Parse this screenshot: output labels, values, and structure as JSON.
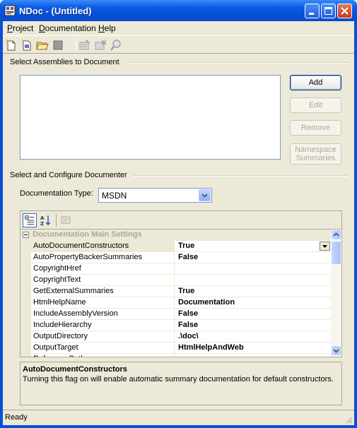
{
  "window": {
    "title": "NDoc - (Untitled)",
    "app_icon": "ndoc-app-icon"
  },
  "caption_buttons": [
    "minimize-icon",
    "maximize-icon",
    "close-icon"
  ],
  "menu": {
    "items": [
      {
        "label": "Project",
        "mnemonic": "P"
      },
      {
        "label": "Documentation",
        "mnemonic": "D"
      },
      {
        "label": "Help",
        "mnemonic": "H"
      }
    ]
  },
  "toolbar": {
    "icons": [
      "new-project-icon",
      "new-from-vs-solution-icon",
      "open-folder-icon",
      "save-icon",
      "build-icon",
      "cancel-build-icon",
      "view-documentation-icon"
    ]
  },
  "assemblies": {
    "group_label": "Select Assemblies to Document",
    "items": [],
    "buttons": {
      "add": "Add",
      "edit": "Edit",
      "remove": "Remove",
      "namespace_summaries": "Namespace Summaries"
    }
  },
  "documenter": {
    "group_label": "Select and Configure Documenter",
    "type_label": "Documentation Type:",
    "type_value": "MSDN"
  },
  "property_grid": {
    "toolbar_icons": [
      "categorized-icon",
      "alphabetical-icon",
      "property-pages-icon"
    ],
    "category": "Documentation Main Settings",
    "rows": [
      {
        "name": "AutoDocumentConstructors",
        "value": "True"
      },
      {
        "name": "AutoPropertyBackerSummaries",
        "value": "False"
      },
      {
        "name": "CopyrightHref",
        "value": ""
      },
      {
        "name": "CopyrightText",
        "value": ""
      },
      {
        "name": "GetExternalSummaries",
        "value": "True"
      },
      {
        "name": "HtmlHelpName",
        "value": "Documentation"
      },
      {
        "name": "IncludeAssemblyVersion",
        "value": "False"
      },
      {
        "name": "IncludeHierarchy",
        "value": "False"
      },
      {
        "name": "OutputDirectory",
        "value": ".\\doc\\"
      },
      {
        "name": "OutputTarget",
        "value": "HtmlHelpAndWeb"
      },
      {
        "name": "ReferencePaths",
        "value": ""
      }
    ],
    "selected_row": 0,
    "help_title": "AutoDocumentConstructors",
    "help_text": "Turning this flag on will enable automatic summary documentation for default constructors."
  },
  "status": {
    "text": "Ready"
  }
}
